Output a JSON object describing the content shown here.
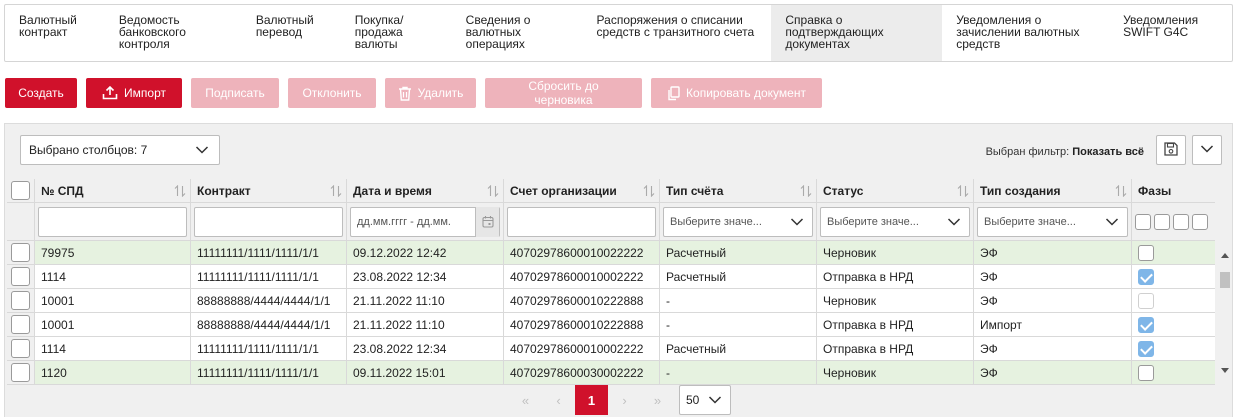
{
  "tabs": [
    {
      "label": "Валютный\nконтракт",
      "active": false
    },
    {
      "label": "Ведомость\nбанковского\nконтроля",
      "active": false
    },
    {
      "label": "Валютный\nперевод",
      "active": false
    },
    {
      "label": "Покупка/\nпродажа\nвалюты",
      "active": false
    },
    {
      "label": "Сведения о\nвалютных\nоперациях",
      "active": false
    },
    {
      "label": "Распоряжения о списании\nсредств с транзитного счета",
      "active": false
    },
    {
      "label": "Справка о\nподтверждающих\nдокументах",
      "active": true
    },
    {
      "label": "Уведомления о\nзачислении валютных\nсредств",
      "active": false
    },
    {
      "label": "Уведомления\nSWIFT G4C",
      "active": false
    }
  ],
  "toolbar": {
    "create": "Создать",
    "import": "Импорт",
    "sign": "Подписать",
    "reject": "Отклонить",
    "delete": "Удалить",
    "reset_draft": "Сбросить до черновика",
    "copy_doc": "Копировать документ"
  },
  "grid_controls": {
    "columns_selected": "Выбрано столбцов: 7",
    "filter_label": "Выбран фильтр:",
    "filter_value": "Показать всё"
  },
  "columns": [
    "№ СПД",
    "Контракт",
    "Дата и время",
    "Счет организации",
    "Тип счёта",
    "Статус",
    "Тип создания",
    "Фазы"
  ],
  "filters": {
    "date_placeholder": "дд.мм.гггг - дд.мм.",
    "select_placeholder": "Выберите значе..."
  },
  "rows": [
    {
      "id": "79975",
      "contract": "11111111/1111/1111/1/1",
      "datetime": "09.12.2022 12:42",
      "account": "40702978600010022222",
      "acc_type": "Расчетный",
      "status": "Черновик",
      "creation": "ЭФ",
      "phase": "empty",
      "green": true
    },
    {
      "id": "1114",
      "contract": "11111111/1111/1111/1/1",
      "datetime": "23.08.2022 12:34",
      "account": "40702978600010002222",
      "acc_type": "Расчетный",
      "status": "Отправка в НРД",
      "creation": "ЭФ",
      "phase": "checked",
      "green": false
    },
    {
      "id": "10001",
      "contract": "88888888/4444/4444/1/1",
      "datetime": "21.11.2022 11:10",
      "account": "40702978600010222888",
      "acc_type": "-",
      "status": "Черновик",
      "creation": "ЭФ",
      "phase": "dim",
      "green": false
    },
    {
      "id": "10001",
      "contract": "88888888/4444/4444/1/1",
      "datetime": "21.11.2022 11:10",
      "account": "40702978600010222888",
      "acc_type": "-",
      "status": "Отправка в НРД",
      "creation": "Импорт",
      "phase": "checked",
      "green": false
    },
    {
      "id": "1114",
      "contract": "11111111/1111/1111/1/1",
      "datetime": "23.08.2022 12:34",
      "account": "40702978600010002222",
      "acc_type": "Расчетный",
      "status": "Отправка в НРД",
      "creation": "ЭФ",
      "phase": "checked",
      "green": false
    },
    {
      "id": "1120",
      "contract": "11111111/1111/1111/1/1",
      "datetime": "09.11.2022 15:01",
      "account": "40702978600030002222",
      "acc_type": "-",
      "status": "Черновик",
      "creation": "ЭФ",
      "phase": "empty",
      "green": true
    }
  ],
  "pager": {
    "current": "1",
    "per_page": "50"
  },
  "colors": {
    "accent": "#d0112b",
    "accent_disabled": "#eeb3bb",
    "row_green": "#e6f2e0",
    "check_blue": "#7fb6e8"
  }
}
